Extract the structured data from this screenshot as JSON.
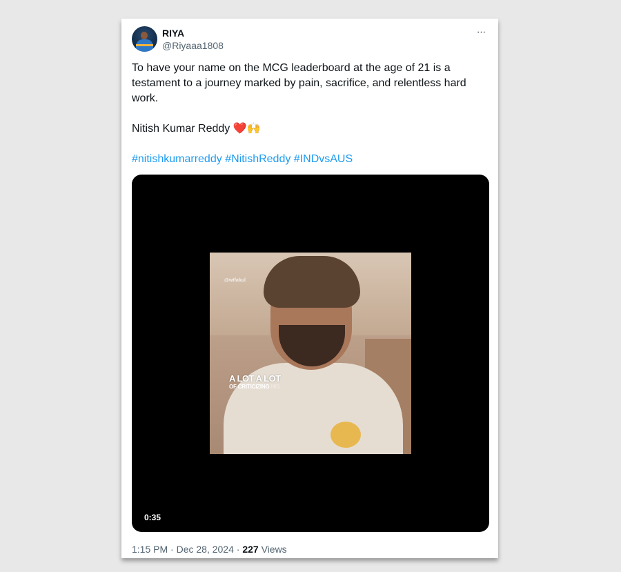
{
  "post": {
    "display_name": "RIYA",
    "handle": "@Riyaaa1808",
    "more_label": "···",
    "text_line1": "To have your name on the MCG leaderboard at the age of 21 is a testament to a journey marked by pain, sacrifice, and relentless hard work.",
    "text_line2": "Nitish Kumar Reddy",
    "emoji_heart": "❤️",
    "emoji_hands": "🙌",
    "hashtags": [
      "#nitishkumarreddy",
      "#NitishReddy",
      "#INDvsAUS"
    ]
  },
  "video": {
    "watermark": "@wtfakul",
    "caption_line1": "A LOT A LOT",
    "caption_line2_visible": "OF CRITICIZING",
    "caption_line2_faded": "HIS",
    "duration": "0:35"
  },
  "footer": {
    "time": "1:15 PM",
    "separator": "·",
    "date": "Dec 28, 2024",
    "views_count": "227",
    "views_label": "Views"
  },
  "colors": {
    "link": "#1d9bf0",
    "text": "#0f1419",
    "secondary": "#536471",
    "heart": "#e0243c"
  }
}
